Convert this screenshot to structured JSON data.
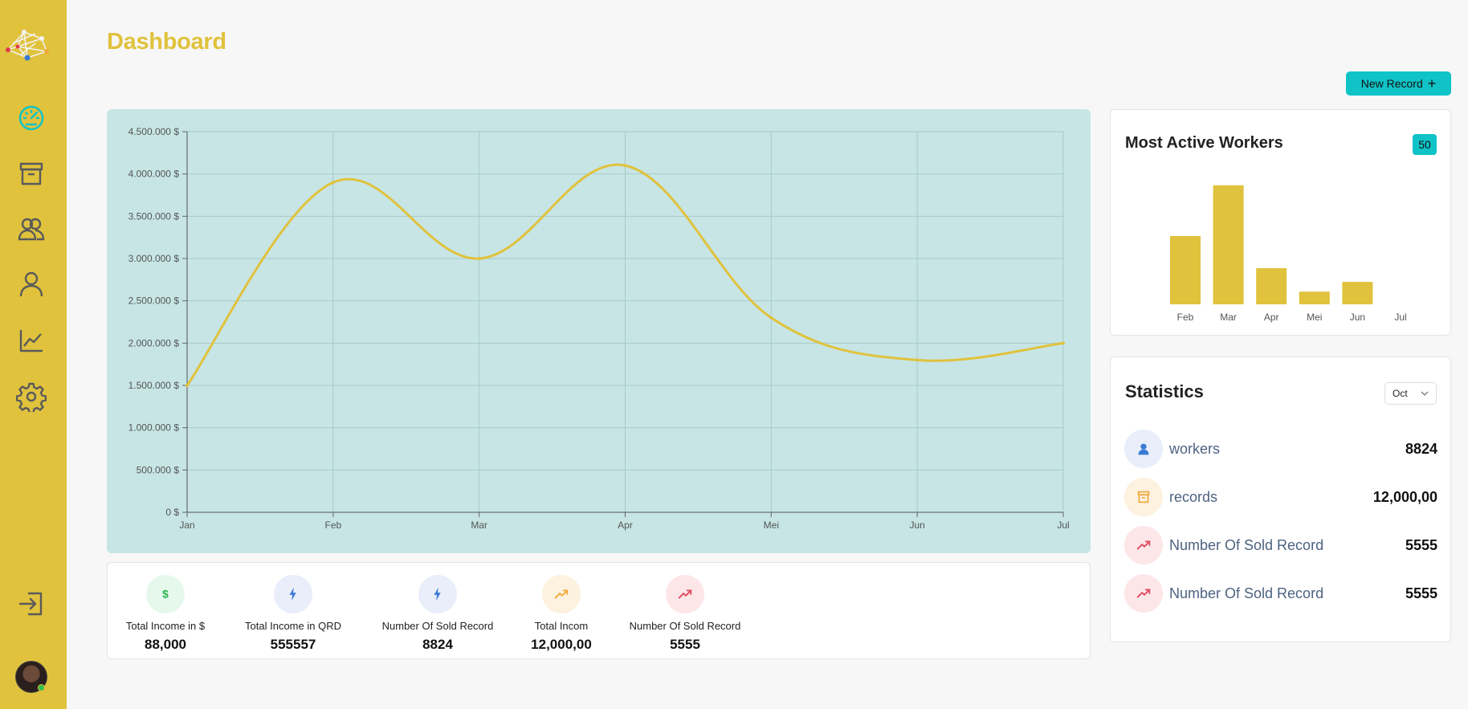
{
  "page": {
    "title": "Dashboard"
  },
  "sidebar": {
    "icons": [
      "speedometer-icon",
      "archive-icon",
      "users-icon",
      "user-icon",
      "chart-line-icon",
      "gear-icon",
      "logout-icon"
    ],
    "accent": "#e0c23d",
    "active_color": "#0fc3c7"
  },
  "toolbar": {
    "new_record_label": "New Record",
    "plus": "+"
  },
  "chart_data": [
    {
      "type": "line",
      "categories": [
        "Jan",
        "Feb",
        "Mar",
        "Apr",
        "Mei",
        "Jun",
        "Jul"
      ],
      "series": [
        {
          "values": [
            1500000,
            3900000,
            3000000,
            4100000,
            2300000,
            1800000,
            2000000
          ]
        }
      ],
      "y_ticks": [
        "0 $",
        "500.000 $",
        "1.000.000 $",
        "1.500.000 $",
        "2.000.000 $",
        "2.500.000 $",
        "3.000.000 $",
        "3.500.000 $",
        "4.000.000 $",
        "4.500.000 $"
      ],
      "ylim": [
        0,
        4500000
      ],
      "grid": true,
      "color": "#e0c23d",
      "background": "#c7e5e5"
    },
    {
      "type": "bar",
      "title": "Most Active Workers",
      "categories": [
        "Feb",
        "Mar",
        "Apr",
        "Mei",
        "Jun",
        "Jul"
      ],
      "values": [
        70,
        122,
        37,
        13,
        23,
        0
      ],
      "ylim": [
        0,
        130
      ],
      "color": "#e0c23d"
    }
  ],
  "workers": {
    "title": "Most Active Workers",
    "badge": "50"
  },
  "kpis": [
    {
      "label": "Total Income in $",
      "value": "88,000",
      "icon": "dollar-icon",
      "bg": "#e6f8ec",
      "color": "#2ab34f"
    },
    {
      "label": "Total Income in QRD",
      "value": "555557",
      "icon": "lightning-icon",
      "bg": "#e9eefa",
      "color": "#3a7bd5"
    },
    {
      "label": "Number Of Sold Record",
      "value": "8824",
      "icon": "lightning-icon",
      "bg": "#e9eefa",
      "color": "#3a7bd5"
    },
    {
      "label": "Total Incom",
      "value": "12,000,00",
      "icon": "trend-up-icon",
      "bg": "#fdf1df",
      "color": "#f0a93a"
    },
    {
      "label": "Number Of Sold Record",
      "value": "5555",
      "icon": "trend-up-icon",
      "bg": "#fde6e8",
      "color": "#e04a5f"
    }
  ],
  "statistics": {
    "title": "Statistics",
    "period": "Oct",
    "rows": [
      {
        "name": "workers",
        "value": "8824",
        "icon": "user-icon",
        "bg": "#e9eefa",
        "color": "#3a7bd5"
      },
      {
        "name": "records",
        "value": "12,000,00",
        "icon": "archive-icon",
        "bg": "#fdf1df",
        "color": "#f0a93a"
      },
      {
        "name": "Number Of Sold Record",
        "value": "5555",
        "icon": "trend-up-icon",
        "bg": "#fde6e8",
        "color": "#e04a5f"
      },
      {
        "name": "Number Of Sold Record",
        "value": "5555",
        "icon": "trend-up-icon",
        "bg": "#fde6e8",
        "color": "#e04a5f"
      }
    ]
  }
}
